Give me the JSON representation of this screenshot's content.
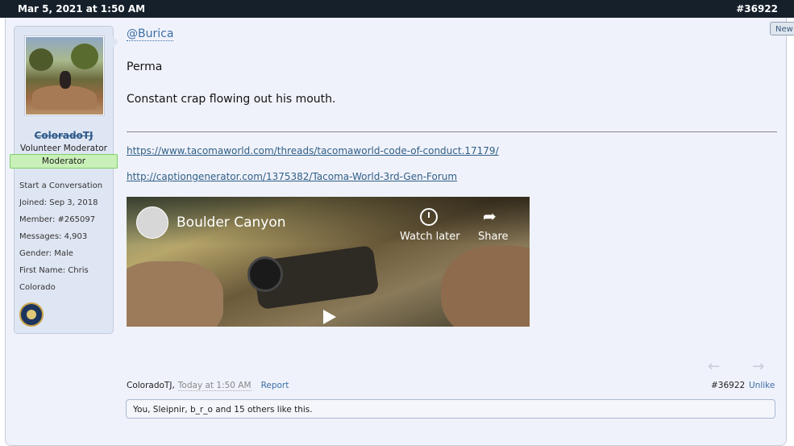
{
  "header": {
    "date": "Mar 5, 2021 at 1:50 AM",
    "post_number": "#36922"
  },
  "new_tab": "New",
  "user": {
    "username": "ColoradoTJ",
    "title": "Volunteer Moderator",
    "banner": "Moderator",
    "start_conversation": "Start a Conversation",
    "info": [
      "Joined:  Sep 3, 2018",
      "Member:  #265097",
      "Messages:  4,903",
      "Gender:  Male",
      "First Name:  Chris",
      "Colorado"
    ],
    "badge_icon": "navy-emblem-icon"
  },
  "message": {
    "mention": "@Burica",
    "line1": "Perma",
    "line2": "Constant crap flowing out his mouth.",
    "link1": "https://www.tacomaworld.com/threads/tacomaworld-code-of-conduct.17179/",
    "link2": "http://captiongenerator.com/1375382/Tacoma-World-3rd-Gen-Forum"
  },
  "video": {
    "title": "Boulder Canyon",
    "watch_later": "Watch later",
    "share": "Share"
  },
  "footer": {
    "author": "ColoradoTJ,",
    "time": "Today at 1:50 AM",
    "report": "Report",
    "post_number": "#36922",
    "unlike": "Unlike",
    "likes": "You, Sleipnir, b_r_o and 15 others like this."
  },
  "colors": {
    "header_bg": "#15202b",
    "post_bg": "#f0f2fb",
    "link": "#2f5f86",
    "moderator_banner": "#c9f0b8"
  }
}
